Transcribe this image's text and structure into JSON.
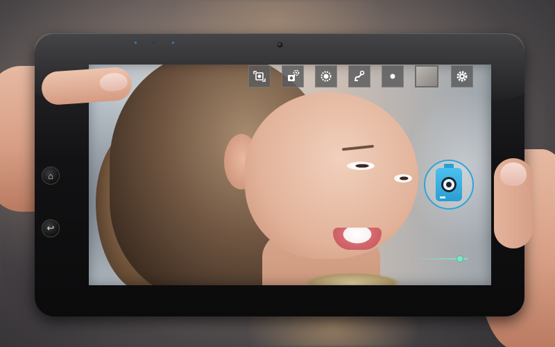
{
  "app": {
    "title": ""
  },
  "device": {
    "buttons": [
      {
        "id": "home",
        "glyph": "⌂",
        "icon": "home-icon"
      },
      {
        "id": "back",
        "glyph": "↩",
        "icon": "back-icon"
      }
    ]
  },
  "toolbar": {
    "tools": [
      {
        "id": "switch-camera",
        "icon": "switch-camera-icon"
      },
      {
        "id": "camera-settings",
        "icon": "camera-gear-icon"
      },
      {
        "id": "exposure",
        "icon": "sun-icon"
      },
      {
        "id": "effects",
        "icon": "magic-wand-icon"
      },
      {
        "id": "record",
        "icon": "dot-icon"
      },
      {
        "id": "gallery",
        "icon": "gallery-thumbnail"
      },
      {
        "id": "settings",
        "icon": "gear-icon"
      }
    ]
  },
  "shutter": {
    "icon": "camera-capture-icon",
    "accent": "#2fa4d8"
  },
  "zoom": {
    "level": 0.9,
    "accent": "#7fe6c8"
  }
}
